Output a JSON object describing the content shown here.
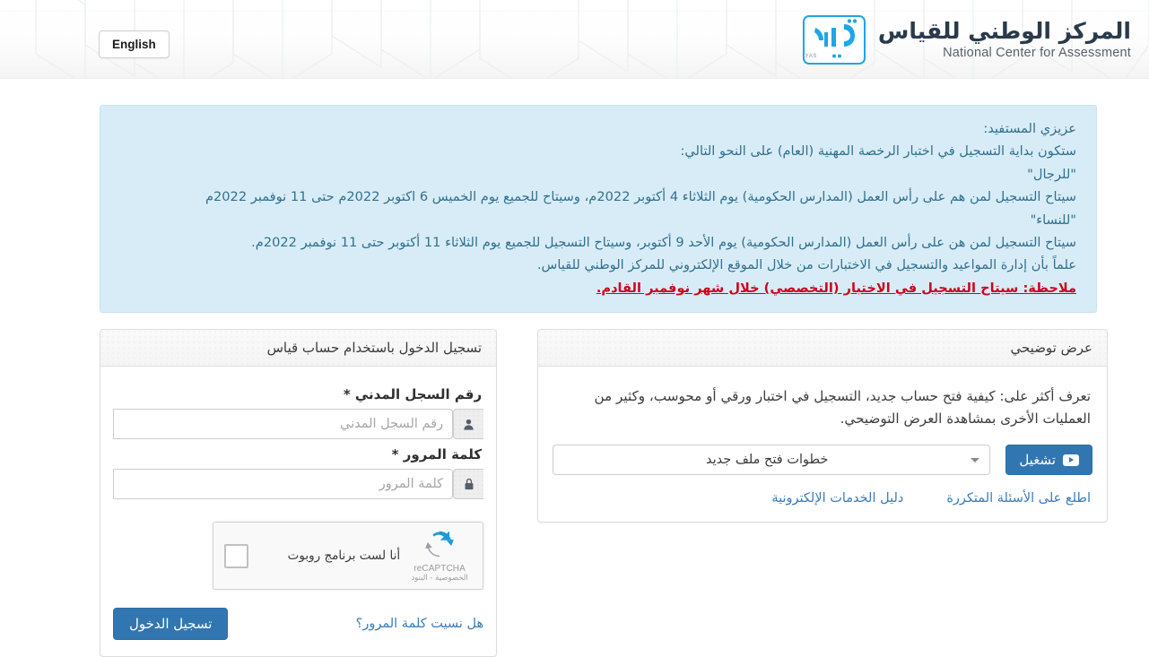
{
  "header": {
    "lang_button": "English",
    "brand_ar": "المركز الوطني للقياس",
    "brand_en": "National Center for Assessment",
    "logo_caption": "QIYAS"
  },
  "notice": {
    "lines": [
      "عزيزي المستفيد:",
      "ستكون بداية التسجيل في اختبار الرخصة المهنية (العام) على النحو التالي:",
      "\"للرجال\"",
      "سيتاح التسجيل لمن هم على رأس العمل (المدارس الحكومية) يوم الثلاثاء 4 أكتوبر 2022م، وسيتاح للجميع يوم الخميس 6 اكتوبر 2022م حتى 11 نوفمبر 2022م",
      "\"للنساء\"",
      "سيتاح التسجيل لمن هن على رأس العمل (المدارس الحكومية) يوم الأحد 9 أكتوبر، وسيتاح التسجيل للجميع يوم الثلاثاء 11 أكتوبر حتى 11 نوفمبر 2022م.",
      "علماً بأن إدارة المواعيد والتسجيل في الاختبارات من خلال الموقع الإلكتروني للمركز الوطني للقياس."
    ],
    "note_red": "ملاحظة: سيتاح التسجيل في الاختبار (التخصصي) خلال شهر نوفمبر القادم."
  },
  "login_panel": {
    "title": "تسجيل الدخول باستخدام حساب قياس",
    "civil_id_label": "رقم السجل المدني *",
    "civil_id_placeholder": "رقم السجل المدني",
    "civil_id_value": "",
    "password_label": "كلمة المرور *",
    "password_placeholder": "كلمة المرور",
    "password_value": "",
    "captcha": {
      "label": "أنا لست برنامج روبوت",
      "brand": "reCAPTCHA",
      "terms": "الخصوصية - البنود"
    },
    "forgot_link": "هل نسيت كلمة المرور؟",
    "submit_button": "تسجيل الدخول"
  },
  "demo_panel": {
    "title": "عرض توضيحي",
    "description": "تعرف أكثر على: كيفية فتح حساب جديد، التسجيل في اختبار ورقي أو محوسب، وكثير من العمليات الأخرى بمشاهدة العرض التوضيحي.",
    "select_value": "خطوات فتح ملف جديد",
    "play_button": "تشغيل",
    "links": [
      "اطلع على الأسئلة المتكررة",
      "دليل الخدمات الإلكترونية"
    ]
  },
  "colors": {
    "accent": "#3276b1",
    "notice_bg": "#d8ecf7",
    "notice_text": "#31708f",
    "alert_red": "#d0021b",
    "logo_blue": "#1fa5e8"
  }
}
